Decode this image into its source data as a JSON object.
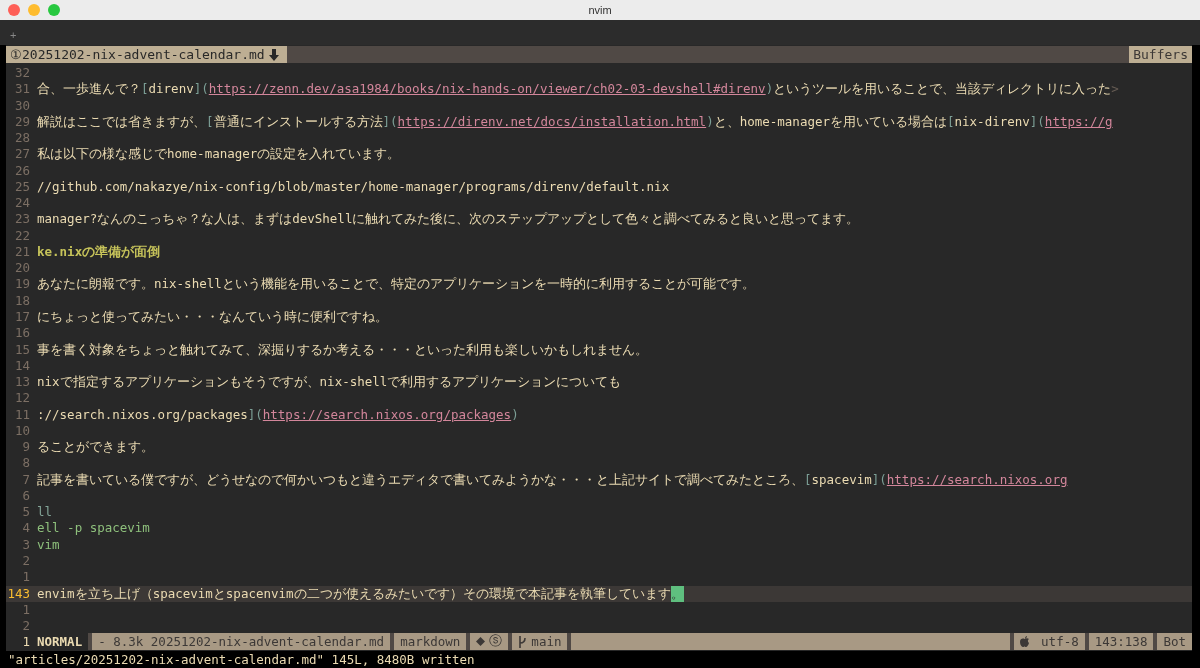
{
  "window": {
    "title": "nvim"
  },
  "terminal_tabs": {
    "new_tab": "+"
  },
  "tabline": {
    "buffer": "①20251202-nix-advent-calendar.md",
    "right": "Buffers"
  },
  "lines": [
    {
      "number": "32",
      "current": false
    },
    {
      "number": "31",
      "current": false,
      "segments": [
        {
          "kind": "text",
          "text": "合、一歩進んで？"
        },
        {
          "kind": "mark",
          "text": "["
        },
        {
          "kind": "text",
          "text": "direnv"
        },
        {
          "kind": "mark",
          "text": "]("
        },
        {
          "kind": "url",
          "text": "https://zenn.dev/asa1984/books/nix-hands-on/viewer/ch02-03-devshell#direnv"
        },
        {
          "kind": "mark",
          "text": ")"
        },
        {
          "kind": "text",
          "text": "というツールを用いることで、当該ディレクトリに入った"
        },
        {
          "kind": "extends",
          "text": ">"
        }
      ]
    },
    {
      "number": "30",
      "current": false
    },
    {
      "number": "29",
      "current": false,
      "segments": [
        {
          "kind": "text",
          "text": "解説はここでは省きますが、"
        },
        {
          "kind": "mark",
          "text": "["
        },
        {
          "kind": "text",
          "text": "普通にインストールする方法"
        },
        {
          "kind": "mark",
          "text": "]("
        },
        {
          "kind": "url",
          "text": "https://direnv.net/docs/installation.html"
        },
        {
          "kind": "mark",
          "text": ")"
        },
        {
          "kind": "text",
          "text": "と、home-managerを用いている場合は"
        },
        {
          "kind": "mark",
          "text": "["
        },
        {
          "kind": "text",
          "text": "nix-direnv"
        },
        {
          "kind": "mark",
          "text": "]("
        },
        {
          "kind": "url",
          "text": "https://g"
        }
      ]
    },
    {
      "number": "28",
      "current": false
    },
    {
      "number": "27",
      "current": false,
      "segments": [
        {
          "kind": "text",
          "text": "私は以下の様な感じでhome-managerの設定を入れています。"
        }
      ]
    },
    {
      "number": "26",
      "current": false
    },
    {
      "number": "25",
      "current": false,
      "segments": [
        {
          "kind": "text",
          "text": "//github.com/nakazye/nix-config/blob/master/home-manager/programs/direnv/default.nix"
        }
      ]
    },
    {
      "number": "24",
      "current": false
    },
    {
      "number": "23",
      "current": false,
      "segments": [
        {
          "kind": "text",
          "text": "manager?なんのこっちゃ？な人は、まずはdevShellに触れてみた後に、次のステップアップとして色々と調べてみると良いと思ってます。"
        }
      ]
    },
    {
      "number": "22",
      "current": false
    },
    {
      "number": "21",
      "current": false,
      "segments": [
        {
          "kind": "heading",
          "text": "ke.nixの準備が面倒"
        }
      ]
    },
    {
      "number": "20",
      "current": false
    },
    {
      "number": "19",
      "current": false,
      "segments": [
        {
          "kind": "text",
          "text": "あなたに朗報です。nix-shellという機能を用いることで、特定のアプリケーションを一時的に利用することが可能です。"
        }
      ]
    },
    {
      "number": "18",
      "current": false
    },
    {
      "number": "17",
      "current": false,
      "segments": [
        {
          "kind": "text",
          "text": "にちょっと使ってみたい・・・なんていう時に便利ですね。"
        }
      ]
    },
    {
      "number": "16",
      "current": false
    },
    {
      "number": "15",
      "current": false,
      "segments": [
        {
          "kind": "text",
          "text": "事を書く対象をちょっと触れてみて、深掘りするか考える・・・といった利用も楽しいかもしれません。"
        }
      ]
    },
    {
      "number": "14",
      "current": false
    },
    {
      "number": "13",
      "current": false,
      "segments": [
        {
          "kind": "text",
          "text": "nixで指定するアプリケーションもそうですが、nix-shellで利用するアプリケーションについても"
        }
      ]
    },
    {
      "number": "12",
      "current": false
    },
    {
      "number": "11",
      "current": false,
      "segments": [
        {
          "kind": "text",
          "text": "://search.nixos.org/packages"
        },
        {
          "kind": "mark",
          "text": "]("
        },
        {
          "kind": "url",
          "text": "https://search.nixos.org/packages"
        },
        {
          "kind": "mark",
          "text": ")"
        }
      ]
    },
    {
      "number": "10",
      "current": false
    },
    {
      "number": "9",
      "current": false,
      "segments": [
        {
          "kind": "text",
          "text": "ることができます。"
        }
      ]
    },
    {
      "number": "8",
      "current": false
    },
    {
      "number": "7",
      "current": false,
      "segments": [
        {
          "kind": "text",
          "text": "記事を書いている僕ですが、どうせなので何かいつもと違うエディタで書いてみようかな・・・と上記サイトで調べてみたところ、"
        },
        {
          "kind": "mark",
          "text": "["
        },
        {
          "kind": "text",
          "text": "spacevim"
        },
        {
          "kind": "mark",
          "text": "]("
        },
        {
          "kind": "url",
          "text": "https://search.nixos.org"
        }
      ]
    },
    {
      "number": "6",
      "current": false
    },
    {
      "number": "5",
      "current": false,
      "segments": [
        {
          "kind": "fence",
          "text": "ll"
        }
      ]
    },
    {
      "number": "4",
      "current": false,
      "segments": [
        {
          "kind": "code",
          "text": "ell -p spacevim"
        }
      ]
    },
    {
      "number": "3",
      "current": false,
      "segments": [
        {
          "kind": "code",
          "text": "vim"
        }
      ]
    },
    {
      "number": "2",
      "current": false
    },
    {
      "number": "1",
      "current": false
    },
    {
      "number": "143",
      "current": true,
      "segments": [
        {
          "kind": "text",
          "text": "envimを立ち上げ（spacevimとspacenvimの二つが使えるみたいです）その環境で本記事を執筆しています"
        },
        {
          "kind": "cursor",
          "text": "。"
        }
      ]
    },
    {
      "number": "1",
      "current": false
    },
    {
      "number": "2",
      "current": false
    }
  ],
  "statusline": {
    "line": "1",
    "mode": "NORMAL",
    "sections": [
      {
        "kind": "text",
        "text": "- 8.3k 20251202-nix-advent-calendar.md"
      },
      {
        "kind": "text",
        "text": "markdown"
      },
      {
        "kind": "icons",
        "text": "ⓢ"
      },
      {
        "kind": "branch",
        "text": "main"
      },
      {
        "kind": "fill"
      },
      {
        "kind": "os",
        "text": "utf-8"
      },
      {
        "kind": "text",
        "text": "143:138"
      },
      {
        "kind": "text",
        "text": "Bot"
      }
    ]
  },
  "command_line": "\"articles/20251202-nix-advent-calendar.md\" 145L, 8480B written"
}
